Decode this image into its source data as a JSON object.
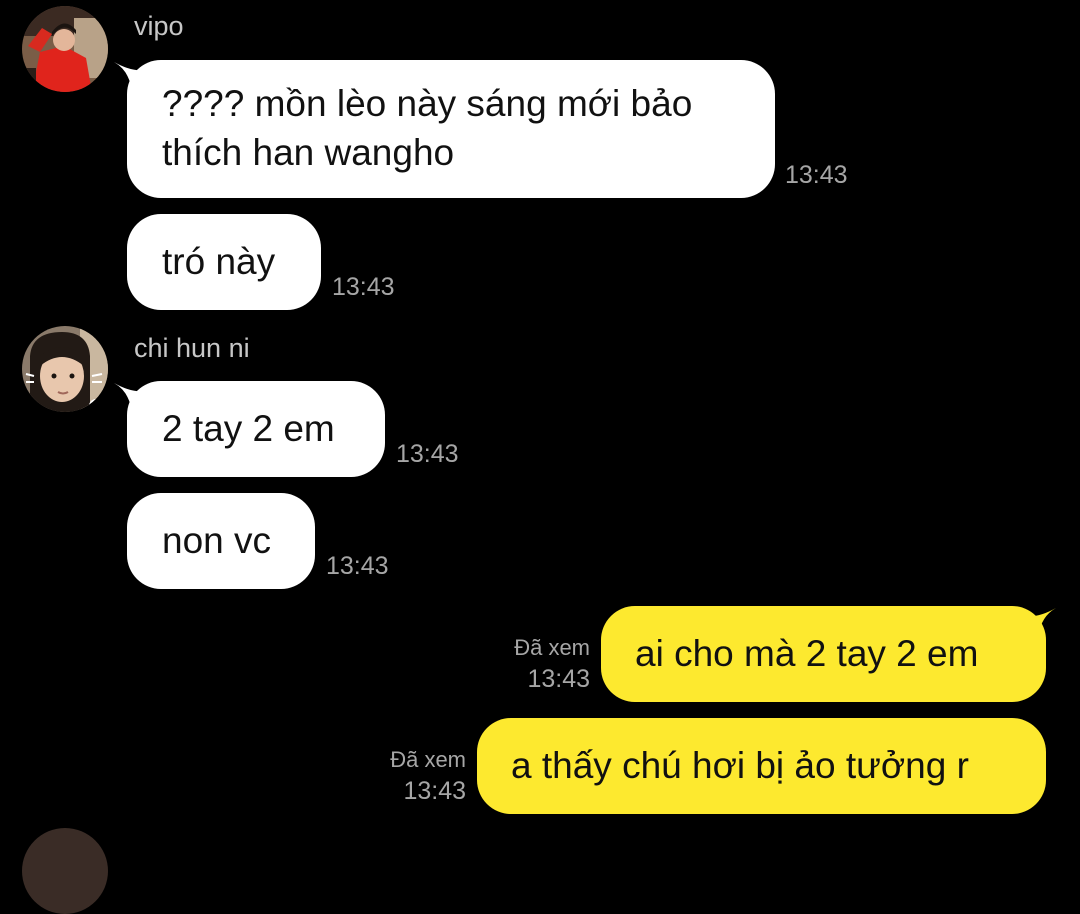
{
  "messages": [
    {
      "sender": "vipo",
      "text_lines": [
        "???? mồn lèo này sáng mới bảo",
        "thích han wangho"
      ],
      "time": "13:43"
    },
    {
      "sender": "vipo",
      "text": "tró này",
      "time": "13:43"
    },
    {
      "sender": "chi hun ni",
      "text": "2 tay 2 em",
      "time": "13:43"
    },
    {
      "sender": "chi hun ni",
      "text": "non vc",
      "time": "13:43"
    },
    {
      "text": "ai cho mà 2 tay 2 em",
      "status": "Đã xem",
      "time": "13:43"
    },
    {
      "text": "a thấy chú hơi bị ảo tưởng r",
      "status": "Đã xem",
      "time": "13:43"
    }
  ],
  "colors": {
    "background": "#000000",
    "incoming_bubble": "#ffffff",
    "outgoing_bubble": "#fde92f",
    "sender_name": "#c7c7c7",
    "timestamp": "#a6a6a6"
  },
  "avatars": [
    "user-avatar-photo",
    "user-avatar-photo"
  ]
}
